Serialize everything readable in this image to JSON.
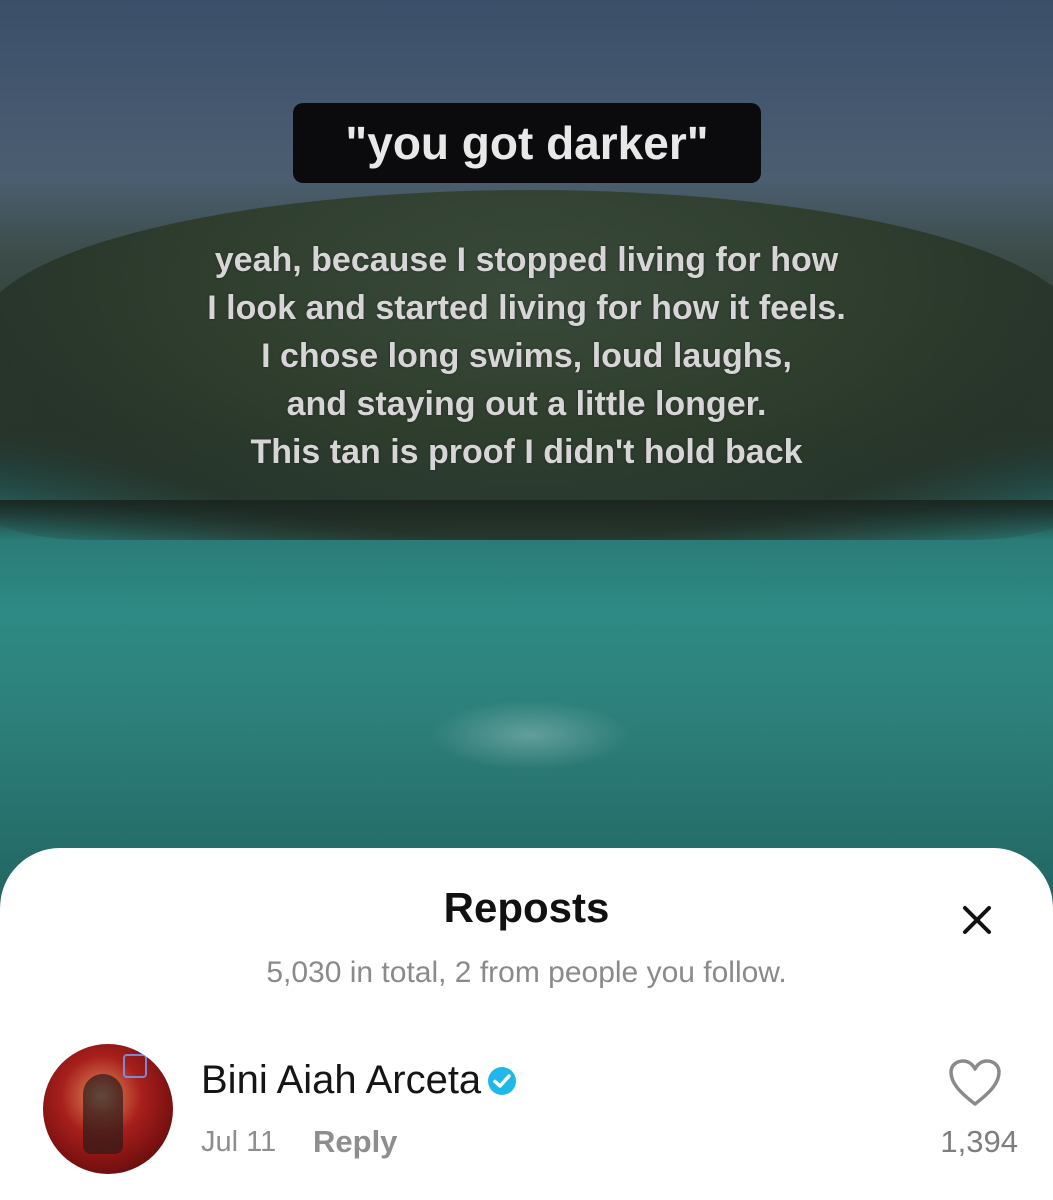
{
  "video": {
    "caption": "\"you got darker\"",
    "overlay_lines": [
      "yeah, because I stopped living for how",
      "I look and started living for how it feels.",
      "I chose long swims, loud laughs,",
      "and staying out a little longer.",
      "This tan is proof I didn't hold back"
    ]
  },
  "sheet": {
    "title": "Reposts",
    "subtitle": "5,030 in total, 2 from people you follow.",
    "close_icon": "close-icon"
  },
  "reposts": [
    {
      "name": "Bini Aiah Arceta",
      "verified": true,
      "date": "Jul 11",
      "reply_label": "Reply",
      "likes": "1,394"
    }
  ],
  "colors": {
    "verified_badge": "#20b8e8",
    "sheet_bg": "#ffffff",
    "caption_bg": "#0b0b0d"
  }
}
